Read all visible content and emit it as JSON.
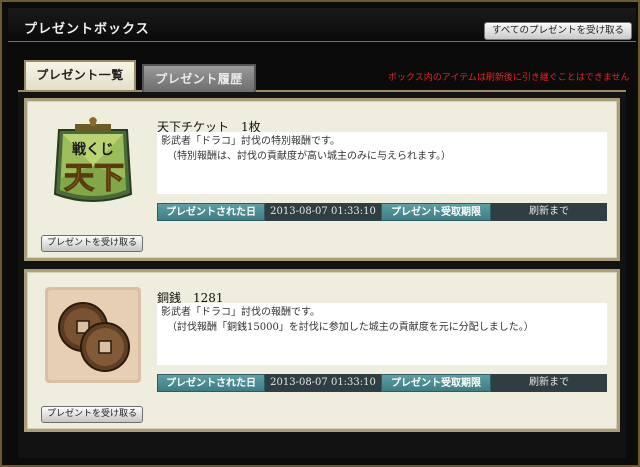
{
  "header": {
    "title": "プレゼントボックス",
    "receive_all_label": "すべてのプレゼントを受け取る"
  },
  "tabs": [
    {
      "label": "プレゼント一覧",
      "active": true
    },
    {
      "label": "プレゼント履歴",
      "active": false
    }
  ],
  "notice": "ボックス内のアイテムは刷新後に引き継ぐことはできません",
  "presents": [
    {
      "name": "天下チケット　1枚",
      "desc_line1": "影武者「ドラコ」討伐の特別報酬です。",
      "desc_line2": "（特別報酬は、討伐の貢献度が高い城主のみに与えられます。）",
      "sent_label": "プレゼントされた日",
      "sent_value": "2013-08-07 01:33:10",
      "deadline_label": "プレゼント受取期限",
      "deadline_value": "刷新まで",
      "receive_label": "プレゼントを受け取る",
      "icon": "tenka-ticket-icon"
    },
    {
      "name": "銅銭　1281",
      "desc_line1": "影武者「ドラコ」討伐の報酬です。",
      "desc_line2": "（討伐報酬「銅銭15000」を討伐に参加した城主の貢献度を元に分配しました。）",
      "sent_label": "プレゼントされた日",
      "sent_value": "2013-08-07 01:33:10",
      "deadline_label": "プレゼント受取期限",
      "deadline_value": "刷新まで",
      "receive_label": "プレゼントを受け取る",
      "icon": "copper-coins-icon"
    }
  ],
  "ticket_text": {
    "top": "戦くじ",
    "big": "天下"
  },
  "colors": {
    "accent_gold": "#8b7431",
    "notice_red": "#e02626",
    "label_teal": "#4f8d94",
    "card_bg": "#efedde"
  }
}
